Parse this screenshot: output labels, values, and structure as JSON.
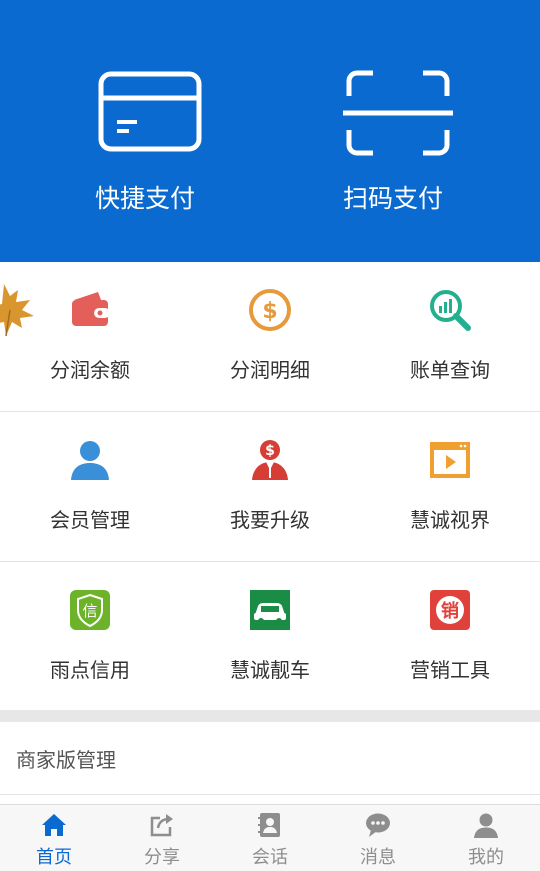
{
  "hero": {
    "quick_pay_label": "快捷支付",
    "scan_pay_label": "扫码支付",
    "background": "#0a6ad0"
  },
  "grid": [
    {
      "label": "分润余额",
      "icon": "wallet-icon",
      "color": "#e45f5a"
    },
    {
      "label": "分润明细",
      "icon": "dollar-coin-icon",
      "color": "#e79a3b"
    },
    {
      "label": "账单查询",
      "icon": "magnifier-chart-icon",
      "color": "#22b08e"
    },
    {
      "label": "会员管理",
      "icon": "member-icon",
      "color": "#3a8fd9"
    },
    {
      "label": "我要升级",
      "icon": "upgrade-icon",
      "color": "#d63d34"
    },
    {
      "label": "慧诚视界",
      "icon": "video-player-icon",
      "color": "#f0a030"
    },
    {
      "label": "雨点信用",
      "icon": "credit-icon",
      "color": "#6cb32a"
    },
    {
      "label": "慧诚靓车",
      "icon": "car-icon",
      "color": "#1a8c46"
    },
    {
      "label": "营销工具",
      "icon": "marketing-icon",
      "color": "#e0413b"
    }
  ],
  "merchant_section": {
    "label": "商家版管理"
  },
  "tabs": [
    {
      "label": "首页",
      "icon": "home-icon",
      "active": true
    },
    {
      "label": "分享",
      "icon": "share-icon",
      "active": false
    },
    {
      "label": "会话",
      "icon": "contacts-icon",
      "active": false
    },
    {
      "label": "消息",
      "icon": "message-icon",
      "active": false
    },
    {
      "label": "我的",
      "icon": "profile-icon",
      "active": false
    }
  ]
}
